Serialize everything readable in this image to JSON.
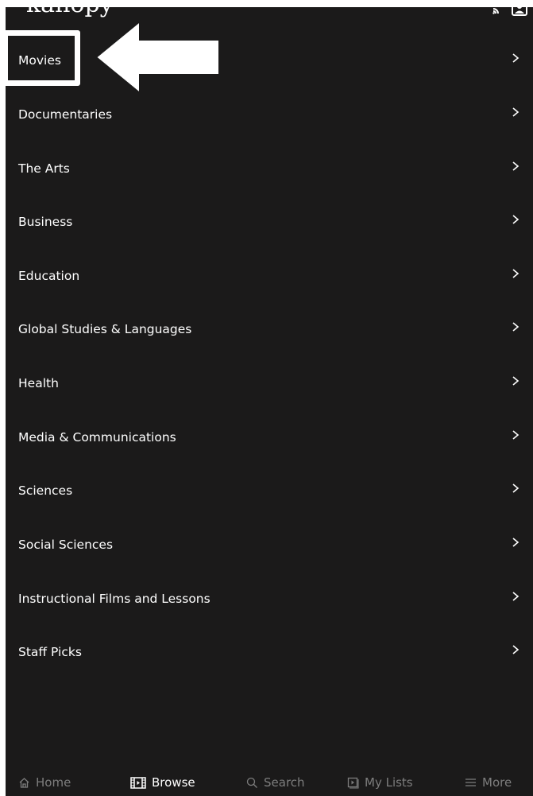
{
  "header": {
    "logo_text": "kanopy"
  },
  "menu": {
    "items": [
      {
        "label": "Movies"
      },
      {
        "label": "Documentaries"
      },
      {
        "label": "The Arts"
      },
      {
        "label": "Business"
      },
      {
        "label": "Education"
      },
      {
        "label": "Global Studies & Languages"
      },
      {
        "label": "Health"
      },
      {
        "label": "Media & Communications"
      },
      {
        "label": "Sciences"
      },
      {
        "label": "Social Sciences"
      },
      {
        "label": "Instructional Films and Lessons"
      },
      {
        "label": "Staff Picks"
      }
    ]
  },
  "tabbar": {
    "home": "Home",
    "browse": "Browse",
    "search": "Search",
    "my_lists": "My Lists",
    "more": "More",
    "active": "browse"
  },
  "colors": {
    "background": "#1b1a1a",
    "text": "#ffffff",
    "inactive_tab": "#7d7d7d",
    "annotation": "#ffffff"
  }
}
